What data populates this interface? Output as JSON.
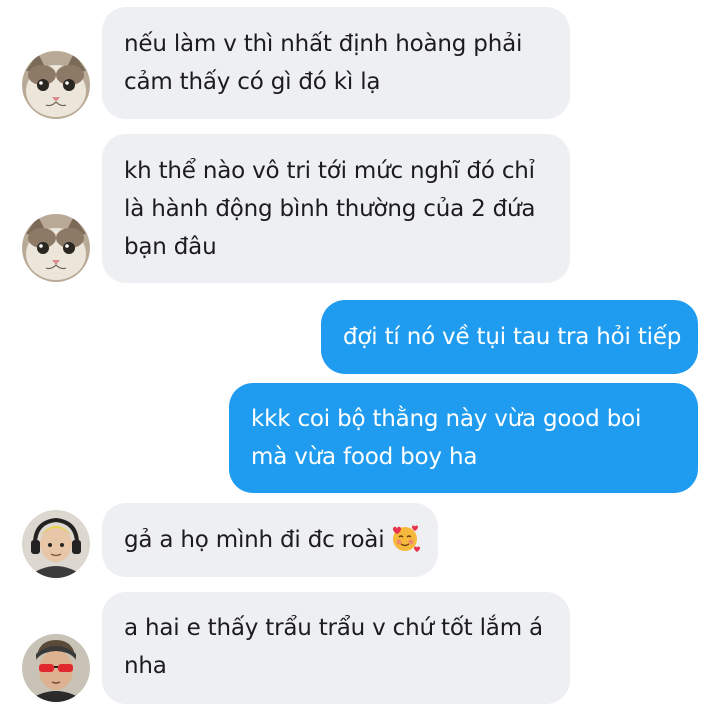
{
  "messages": [
    {
      "direction": "in",
      "sender_avatar": "cat-avatar",
      "lines": [
        "nếu làm v thì nhất định hoàng phải",
        "cảm thấy có gì đó kì lạ"
      ]
    },
    {
      "direction": "in",
      "sender_avatar": "cat-avatar",
      "lines": [
        "kh thể nào vô tri tới mức nghĩ đó chỉ",
        "là hành động bình thường của 2 đứa",
        "bạn đâu"
      ]
    },
    {
      "direction": "out",
      "lines": [
        "đợi tí nó về tụi tau tra hỏi tiếp"
      ]
    },
    {
      "direction": "out",
      "lines": [
        "kkk coi bộ thằng này vừa good boi",
        "mà vừa food boy ha"
      ]
    },
    {
      "direction": "in",
      "sender_avatar": "headphones-person-avatar",
      "lines": [
        "gả a họ mình đi đc roài"
      ],
      "emoji": "smiling-face-with-hearts-icon"
    },
    {
      "direction": "in",
      "sender_avatar": "red-glasses-person-avatar",
      "lines": [
        "a hai e thấy trẩu trẩu v chứ tốt lắm á",
        "nha"
      ]
    }
  ],
  "colors": {
    "incoming_bubble": "#eeeff2",
    "outgoing_bubble": "#1f9cf0",
    "incoming_text": "#1c1c1c",
    "outgoing_text": "#ffffff"
  }
}
